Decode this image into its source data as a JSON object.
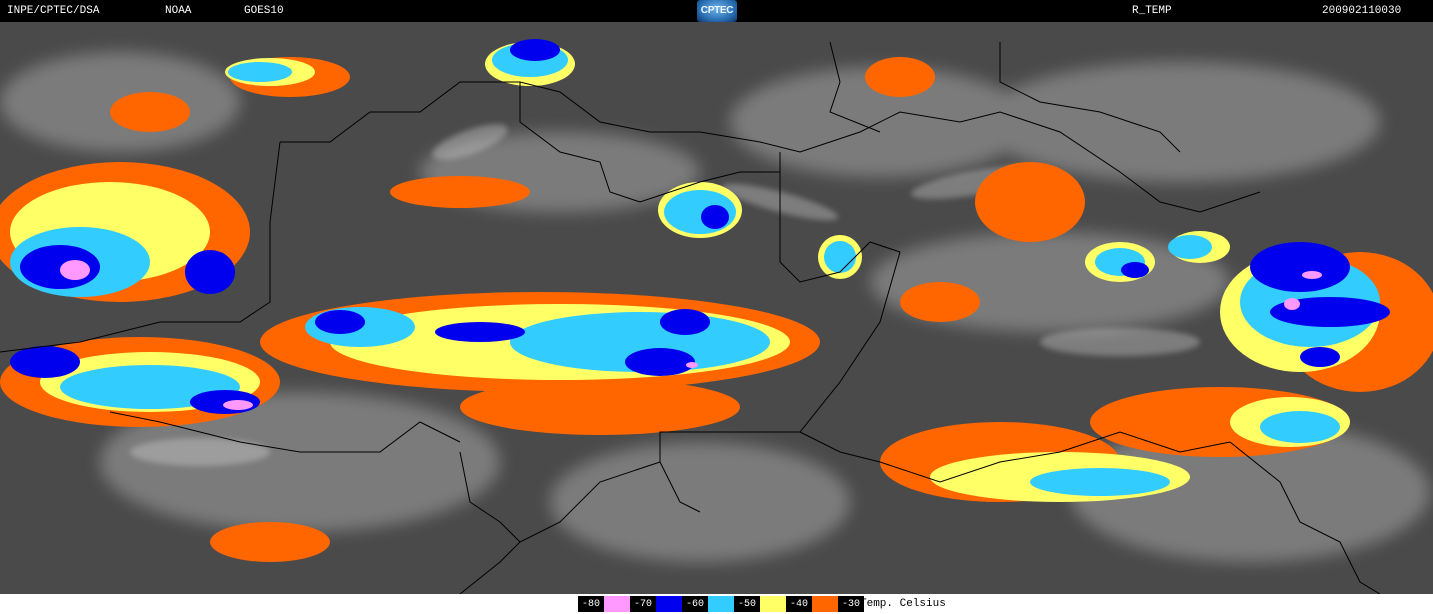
{
  "header": {
    "institution": "INPE/CPTEC/DSA",
    "agency": "NOAA",
    "satellite": "GOES10",
    "product": "R_TEMP",
    "timestamp": "200902110030",
    "logo_text": "CPTEC"
  },
  "image": {
    "type": "infrared satellite image with enhanced cloud-top temperature colors",
    "colors": {
      "background": "#4a4a4a",
      "cloud_light": "#c8c8c8",
      "minus30": "#ff6600",
      "minus40": "#ffff66",
      "minus50": "#33ccff",
      "minus60": "#0000ee",
      "minus70": "#ff99ff",
      "borders": "#000000"
    }
  },
  "legend": {
    "scale": [
      {
        "label": "-80",
        "color": "#ff99ff"
      },
      {
        "label": "-70",
        "color": "#0000ee"
      },
      {
        "label": "-60",
        "color": "#33ccff"
      },
      {
        "label": "-50",
        "color": "#ffff66"
      },
      {
        "label": "-40",
        "color": "#ff6600"
      },
      {
        "label": "-30",
        "color": "#ff6600"
      }
    ],
    "unit": "Temp. Celsius"
  }
}
